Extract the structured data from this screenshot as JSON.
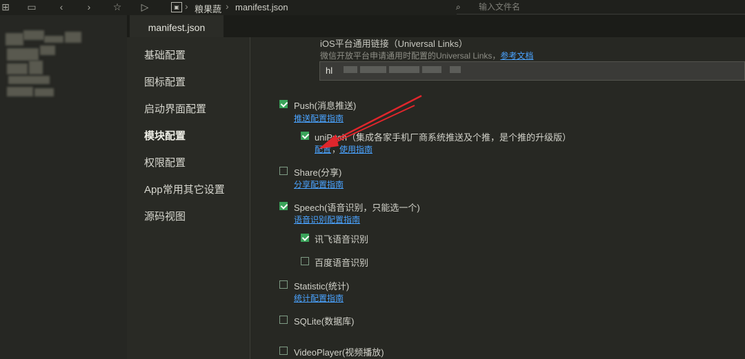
{
  "toolbar": {
    "icons": [
      "new-file-icon",
      "save-icon",
      "back-icon",
      "forward-icon",
      "star-icon",
      "run-icon"
    ],
    "breadcrumb_project_icon": "project-icon",
    "breadcrumb": [
      "粮果蔬",
      "manifest.json"
    ],
    "search_placeholder": "输入文件名"
  },
  "tab": {
    "label": "manifest.json"
  },
  "nav": {
    "items": [
      "基础配置",
      "图标配置",
      "启动界面配置",
      "模块配置",
      "权限配置",
      "App常用其它设置",
      "源码视图"
    ],
    "active_index": 3
  },
  "ios_links": {
    "title": "iOS平台通用链接（Universal Links）",
    "desc_prefix": "微信开放平台申请通用时配置的Universal Links，",
    "desc_link": "参考文档",
    "input_value": "hl"
  },
  "modules": {
    "push": {
      "label": "Push(消息推送)",
      "checked": true,
      "guide": "推送配置指南"
    },
    "unipush": {
      "label": "uniPush（集成各家手机厂商系统推送及个推，是个推的升级版）",
      "checked": true,
      "link_config": "配置",
      "separator": "，",
      "link_usage": "使用指南"
    },
    "share": {
      "label": "Share(分享)",
      "checked": false,
      "guide": "分享配置指南"
    },
    "speech": {
      "label": "Speech(语音识别，只能选一个)",
      "checked": true,
      "guide": "语音识别配置指南"
    },
    "xunfei": {
      "label": "讯飞语音识别",
      "checked": true
    },
    "baidu": {
      "label": "百度语音识别",
      "checked": false
    },
    "statistic": {
      "label": "Statistic(统计)",
      "checked": false,
      "guide": "统计配置指南"
    },
    "sqlite": {
      "label": "SQLite(数据库)",
      "checked": false
    },
    "videoplayer": {
      "label": "VideoPlayer(视频播放)",
      "checked": false
    }
  },
  "colors": {
    "accent_link": "#4aa3ff",
    "checkbox_on": "#3aa35a",
    "annotation_arrow": "#e0262c"
  }
}
